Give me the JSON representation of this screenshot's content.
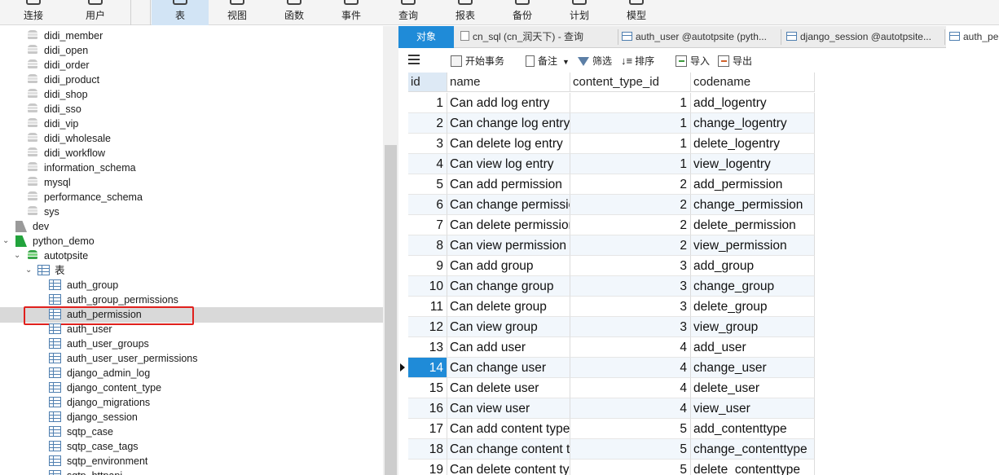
{
  "toolbar": {
    "items": [
      {
        "label": "连接",
        "icon": "connection-icon"
      },
      {
        "label": "用户",
        "icon": "user-icon"
      },
      {
        "label": "表",
        "icon": "table-icon",
        "active": true
      },
      {
        "label": "视图",
        "icon": "view-icon"
      },
      {
        "label": "函数",
        "icon": "function-icon"
      },
      {
        "label": "事件",
        "icon": "event-icon"
      },
      {
        "label": "查询",
        "icon": "query-icon"
      },
      {
        "label": "报表",
        "icon": "report-icon"
      },
      {
        "label": "备份",
        "icon": "backup-icon"
      },
      {
        "label": "计划",
        "icon": "schedule-icon"
      },
      {
        "label": "模型",
        "icon": "model-icon"
      }
    ]
  },
  "tree": {
    "databases": [
      "didi_member",
      "didi_open",
      "didi_order",
      "didi_product",
      "didi_shop",
      "didi_sso",
      "didi_vip",
      "didi_wholesale",
      "didi_workflow",
      "information_schema",
      "mysql",
      "performance_schema",
      "sys"
    ],
    "connections": [
      "dev",
      "python_demo"
    ],
    "schema": "autotpsite",
    "tables_folder": "表",
    "tables": [
      "auth_group",
      "auth_group_permissions",
      "auth_permission",
      "auth_user",
      "auth_user_groups",
      "auth_user_user_permissions",
      "django_admin_log",
      "django_content_type",
      "django_migrations",
      "django_session",
      "sqtp_case",
      "sqtp_case_tags",
      "sqtp_environment",
      "sqtp_httpapi"
    ],
    "selected_table": "auth_permission"
  },
  "tabs": {
    "object_tab": "对象",
    "items": [
      "cn_sql (cn_润天下) - 查询",
      "auth_user @autotpsite (pyth...",
      "django_session @autotpsite...",
      "auth_pe"
    ]
  },
  "object_toolbar": {
    "begin_transaction": "开始事务",
    "memo": "备注",
    "filter": "筛选",
    "sort": "排序",
    "import": "导入",
    "export": "导出"
  },
  "grid": {
    "columns": [
      "id",
      "name",
      "content_type_id",
      "codename"
    ],
    "current_row_id": "14",
    "rows": [
      [
        "1",
        "Can add log entry",
        "1",
        "add_logentry"
      ],
      [
        "2",
        "Can change log entry",
        "1",
        "change_logentry"
      ],
      [
        "3",
        "Can delete log entry",
        "1",
        "delete_logentry"
      ],
      [
        "4",
        "Can view log entry",
        "1",
        "view_logentry"
      ],
      [
        "5",
        "Can add permission",
        "2",
        "add_permission"
      ],
      [
        "6",
        "Can change permission",
        "2",
        "change_permission"
      ],
      [
        "7",
        "Can delete permission",
        "2",
        "delete_permission"
      ],
      [
        "8",
        "Can view permission",
        "2",
        "view_permission"
      ],
      [
        "9",
        "Can add group",
        "3",
        "add_group"
      ],
      [
        "10",
        "Can change group",
        "3",
        "change_group"
      ],
      [
        "11",
        "Can delete group",
        "3",
        "delete_group"
      ],
      [
        "12",
        "Can view group",
        "3",
        "view_group"
      ],
      [
        "13",
        "Can add user",
        "4",
        "add_user"
      ],
      [
        "14",
        "Can change user",
        "4",
        "change_user"
      ],
      [
        "15",
        "Can delete user",
        "4",
        "delete_user"
      ],
      [
        "16",
        "Can view user",
        "4",
        "view_user"
      ],
      [
        "17",
        "Can add content type",
        "5",
        "add_contenttype"
      ],
      [
        "18",
        "Can change content type",
        "5",
        "change_contenttype"
      ],
      [
        "19",
        "Can delete content type",
        "5",
        "delete_contenttype"
      ]
    ]
  }
}
